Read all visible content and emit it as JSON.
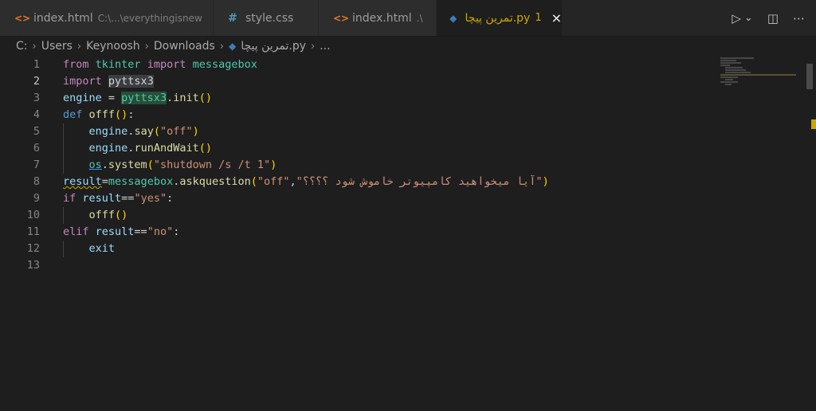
{
  "tabs": [
    {
      "title": "index.html",
      "sub": "C:\\...\\everythingisnew",
      "icon": "html-icon"
    },
    {
      "title": "style.css",
      "sub": "",
      "icon": "css-icon"
    },
    {
      "title": "index.html",
      "sub": ".\\",
      "icon": "html-icon"
    },
    {
      "title": "تمرین پیچا.py",
      "problems": "1",
      "close": "×",
      "icon": "python-icon"
    }
  ],
  "actions": {
    "run": "▷",
    "run_menu": "⌄",
    "split": "◫",
    "more": "⋯"
  },
  "breadcrumb": {
    "drive": "C:",
    "users": "Users",
    "user": "Keynoosh",
    "folder": "Downloads",
    "file": "تمرین پیچا.py",
    "tail": "..."
  },
  "line_numbers": [
    "1",
    "2",
    "3",
    "4",
    "5",
    "6",
    "7",
    "8",
    "9",
    "10",
    "11",
    "12",
    "13"
  ],
  "code": {
    "l1": {
      "from": "from",
      "mod": "tkinter",
      "imp": "import",
      "name": "messagebox"
    },
    "l2": {
      "imp": "import",
      "mod": "pyttsx3"
    },
    "l3": {
      "var": "engine",
      "eq": " = ",
      "mod": "pyttsx3",
      "dot": ".",
      "fn": "init",
      "p": "()"
    },
    "l4": {
      "def": "def",
      "fn": "offf",
      "p": "()",
      "colon": ":"
    },
    "l5": {
      "indent": "    ",
      "var": "engine",
      "dot": ".",
      "fn": "say",
      "po": "(",
      "str": "\"off\"",
      "pc": ")"
    },
    "l6": {
      "indent": "    ",
      "var": "engine",
      "dot": ".",
      "fn": "runAndWait",
      "p": "()"
    },
    "l7": {
      "indent": "    ",
      "mod": "os",
      "dot": ".",
      "fn": "system",
      "po": "(",
      "str": "\"shutdown /s /t 1\"",
      "pc": ")"
    },
    "l8": {
      "var": "result",
      "eq": "=",
      "mod": "messagebox",
      "dot": ".",
      "fn": "askquestion",
      "po": "(",
      "str1": "\"off\"",
      "comma": ",",
      "str2": "\"آیا میخواهید کامپیوتر خاموش شود ؟؟؟؟\"",
      "pc": ")"
    },
    "l9": {
      "kw": "if",
      "var": " result",
      "op": "==",
      "str": "\"yes\"",
      "colon": ":"
    },
    "l10": {
      "indent": "    ",
      "fn": "offf",
      "p": "()"
    },
    "l11": {
      "kw": "elif",
      "var": " result",
      "op": "==",
      "str": "\"no\"",
      "colon": ":"
    },
    "l12": {
      "indent": "    ",
      "var": "exit"
    },
    "l13": {}
  }
}
